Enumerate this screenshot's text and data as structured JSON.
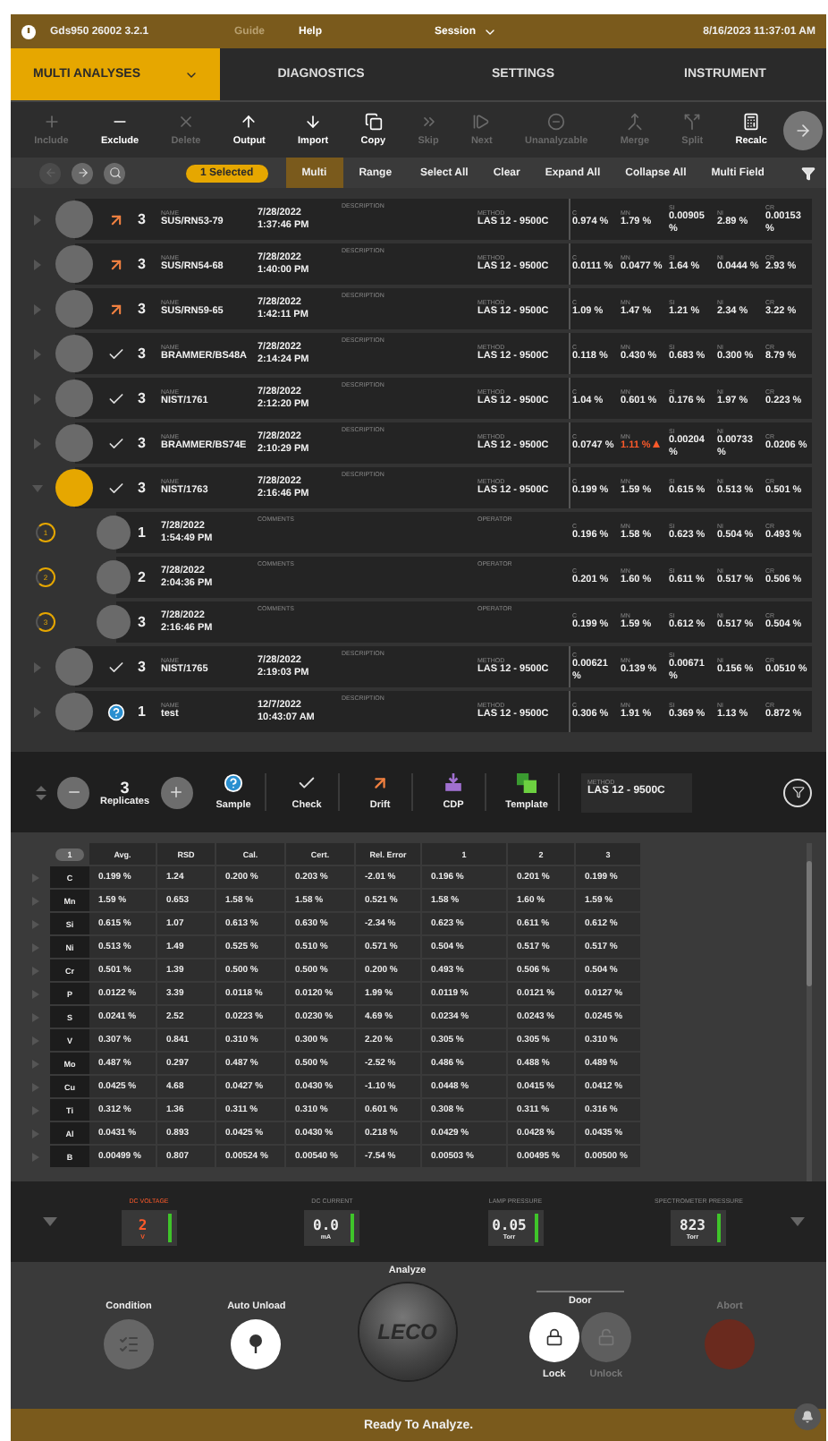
{
  "title_bar": {
    "app": "Gds950 26002 3.2.1",
    "menu": [
      {
        "label": "Guide",
        "disabled": true
      },
      {
        "label": "Help",
        "disabled": false
      }
    ],
    "session": "Session",
    "datetime": "8/16/2023 11:37:01 AM"
  },
  "nav_tabs": [
    {
      "label": "MULTI ANALYSES",
      "selected": true
    },
    {
      "label": "DIAGNOSTICS",
      "selected": false
    },
    {
      "label": "SETTINGS",
      "selected": false
    },
    {
      "label": "INSTRUMENT",
      "selected": false
    }
  ],
  "toolbar": [
    {
      "label": "Include",
      "kind": "include",
      "disabled": true
    },
    {
      "label": "Exclude",
      "kind": "exclude",
      "disabled": false
    },
    {
      "label": "Delete",
      "kind": "delete",
      "disabled": true
    },
    {
      "label": "Output",
      "kind": "output",
      "disabled": false
    },
    {
      "label": "Import",
      "kind": "import",
      "disabled": false
    },
    {
      "label": "Copy",
      "kind": "copy",
      "disabled": false
    },
    {
      "label": "Skip",
      "kind": "skip",
      "disabled": true
    },
    {
      "label": "Next",
      "kind": "next",
      "disabled": true
    },
    {
      "label": "Unanalyzable",
      "kind": "unanalyzable",
      "disabled": true
    },
    {
      "label": "Merge",
      "kind": "merge",
      "disabled": true
    },
    {
      "label": "Split",
      "kind": "split",
      "disabled": true
    },
    {
      "label": "Recalc",
      "kind": "recalc",
      "disabled": false
    }
  ],
  "filter_bar": {
    "nav_buttons": [
      {
        "kind": "back",
        "disabled": true
      },
      {
        "kind": "forward",
        "disabled": false
      },
      {
        "kind": "search",
        "disabled": false
      }
    ],
    "selection": "1 Selected",
    "modes": [
      {
        "label": "Multi",
        "selected": true
      },
      {
        "label": "Range",
        "selected": false
      }
    ],
    "actions": [
      "Select All",
      "Clear",
      "Expand All",
      "Collapse All",
      "Multi Field"
    ]
  },
  "samples": [
    {
      "kind": "drift",
      "replicates": "3",
      "labels": [
        "NAME",
        "DESCRIPTION",
        "METHOD"
      ],
      "name": "SUS/RN53-79",
      "date": "7/28/2022",
      "time": "1:37:46 PM",
      "method": "LAS 12 - 9500C",
      "expanded": false,
      "selected": false,
      "values": [
        {
          "el": "C",
          "v": "0.974 %",
          "flag": false
        },
        {
          "el": "MN",
          "v": "1.79 %",
          "flag": false
        },
        {
          "el": "SI",
          "v": "0.00905 %",
          "flag": false
        },
        {
          "el": "NI",
          "v": "2.89 %",
          "flag": false
        },
        {
          "el": "CR",
          "v": "0.00153 %",
          "flag": false
        }
      ]
    },
    {
      "kind": "drift",
      "replicates": "3",
      "labels": [
        "NAME",
        "DESCRIPTION",
        "METHOD"
      ],
      "name": "SUS/RN54-68",
      "date": "7/28/2022",
      "time": "1:40:00 PM",
      "method": "LAS 12 - 9500C",
      "expanded": false,
      "selected": false,
      "values": [
        {
          "el": "C",
          "v": "0.0111 %",
          "flag": false
        },
        {
          "el": "MN",
          "v": "0.0477 %",
          "flag": false
        },
        {
          "el": "SI",
          "v": "1.64 %",
          "flag": false
        },
        {
          "el": "NI",
          "v": "0.0444 %",
          "flag": false
        },
        {
          "el": "CR",
          "v": "2.93 %",
          "flag": false
        }
      ]
    },
    {
      "kind": "drift",
      "replicates": "3",
      "labels": [
        "NAME",
        "DESCRIPTION",
        "METHOD"
      ],
      "name": "SUS/RN59-65",
      "date": "7/28/2022",
      "time": "1:42:11 PM",
      "method": "LAS 12 - 9500C",
      "expanded": false,
      "selected": false,
      "values": [
        {
          "el": "C",
          "v": "1.09 %",
          "flag": false
        },
        {
          "el": "MN",
          "v": "1.47 %",
          "flag": false
        },
        {
          "el": "SI",
          "v": "1.21 %",
          "flag": false
        },
        {
          "el": "NI",
          "v": "2.34 %",
          "flag": false
        },
        {
          "el": "CR",
          "v": "3.22 %",
          "flag": false
        }
      ]
    },
    {
      "kind": "check",
      "replicates": "3",
      "labels": [
        "NAME",
        "DESCRIPTION",
        "METHOD"
      ],
      "name": "BRAMMER/BS48A",
      "date": "7/28/2022",
      "time": "2:14:24 PM",
      "method": "LAS 12 - 9500C",
      "expanded": false,
      "selected": false,
      "values": [
        {
          "el": "C",
          "v": "0.118 %",
          "flag": false
        },
        {
          "el": "MN",
          "v": "0.430 %",
          "flag": false
        },
        {
          "el": "SI",
          "v": "0.683 %",
          "flag": false
        },
        {
          "el": "NI",
          "v": "0.300 %",
          "flag": false
        },
        {
          "el": "CR",
          "v": "8.79 %",
          "flag": false
        }
      ]
    },
    {
      "kind": "check",
      "replicates": "3",
      "labels": [
        "NAME",
        "DESCRIPTION",
        "METHOD"
      ],
      "name": "NIST/1761",
      "date": "7/28/2022",
      "time": "2:12:20 PM",
      "method": "LAS 12 - 9500C",
      "expanded": false,
      "selected": false,
      "values": [
        {
          "el": "C",
          "v": "1.04 %",
          "flag": false
        },
        {
          "el": "MN",
          "v": "0.601 %",
          "flag": false
        },
        {
          "el": "SI",
          "v": "0.176 %",
          "flag": false
        },
        {
          "el": "NI",
          "v": "1.97 %",
          "flag": false
        },
        {
          "el": "CR",
          "v": "0.223 %",
          "flag": false
        }
      ]
    },
    {
      "kind": "check",
      "replicates": "3",
      "labels": [
        "NAME",
        "DESCRIPTION",
        "METHOD"
      ],
      "name": "BRAMMER/BS74E",
      "date": "7/28/2022",
      "time": "2:10:29 PM",
      "method": "LAS 12 - 9500C",
      "expanded": false,
      "selected": false,
      "values": [
        {
          "el": "C",
          "v": "0.0747 %",
          "flag": false
        },
        {
          "el": "MN",
          "v": "1.11 %",
          "flag": true
        },
        {
          "el": "SI",
          "v": "0.00204 %",
          "flag": false
        },
        {
          "el": "NI",
          "v": "0.00733 %",
          "flag": false
        },
        {
          "el": "CR",
          "v": "0.0206 %",
          "flag": false
        }
      ]
    },
    {
      "kind": "check",
      "replicates": "3",
      "labels": [
        "NAME",
        "DESCRIPTION",
        "METHOD"
      ],
      "name": "NIST/1763",
      "date": "7/28/2022",
      "time": "2:16:46 PM",
      "method": "LAS 12 - 9500C",
      "expanded": true,
      "selected": true,
      "values": [
        {
          "el": "C",
          "v": "0.199 %",
          "flag": false
        },
        {
          "el": "MN",
          "v": "1.59 %",
          "flag": false
        },
        {
          "el": "SI",
          "v": "0.615 %",
          "flag": false
        },
        {
          "el": "NI",
          "v": "0.513 %",
          "flag": false
        },
        {
          "el": "CR",
          "v": "0.501 %",
          "flag": false
        }
      ],
      "children": [
        {
          "ring": "1",
          "number": "1",
          "labels": [
            "COMMENTS",
            "OPERATOR"
          ],
          "date": "7/28/2022",
          "time": "1:54:49 PM",
          "values": [
            {
              "el": "C",
              "v": "0.196 %",
              "flag": false
            },
            {
              "el": "MN",
              "v": "1.58 %",
              "flag": false
            },
            {
              "el": "SI",
              "v": "0.623 %",
              "flag": false
            },
            {
              "el": "NI",
              "v": "0.504 %",
              "flag": false
            },
            {
              "el": "CR",
              "v": "0.493 %",
              "flag": false
            }
          ]
        },
        {
          "ring": "2",
          "number": "2",
          "labels": [
            "COMMENTS",
            "OPERATOR"
          ],
          "date": "7/28/2022",
          "time": "2:04:36 PM",
          "values": [
            {
              "el": "C",
              "v": "0.201 %",
              "flag": false
            },
            {
              "el": "MN",
              "v": "1.60 %",
              "flag": false
            },
            {
              "el": "SI",
              "v": "0.611 %",
              "flag": false
            },
            {
              "el": "NI",
              "v": "0.517 %",
              "flag": false
            },
            {
              "el": "CR",
              "v": "0.506 %",
              "flag": false
            }
          ]
        },
        {
          "ring": "3",
          "number": "3",
          "labels": [
            "COMMENTS",
            "OPERATOR"
          ],
          "date": "7/28/2022",
          "time": "2:16:46 PM",
          "values": [
            {
              "el": "C",
              "v": "0.199 %",
              "flag": false
            },
            {
              "el": "MN",
              "v": "1.59 %",
              "flag": false
            },
            {
              "el": "SI",
              "v": "0.612 %",
              "flag": false
            },
            {
              "el": "NI",
              "v": "0.517 %",
              "flag": false
            },
            {
              "el": "CR",
              "v": "0.504 %",
              "flag": false
            }
          ]
        }
      ]
    },
    {
      "kind": "check",
      "replicates": "3",
      "labels": [
        "NAME",
        "DESCRIPTION",
        "METHOD"
      ],
      "name": "NIST/1765",
      "date": "7/28/2022",
      "time": "2:19:03 PM",
      "method": "LAS 12 - 9500C",
      "expanded": false,
      "selected": false,
      "values": [
        {
          "el": "C",
          "v": "0.00621 %",
          "flag": false
        },
        {
          "el": "MN",
          "v": "0.139 %",
          "flag": false
        },
        {
          "el": "SI",
          "v": "0.00671 %",
          "flag": false
        },
        {
          "el": "NI",
          "v": "0.156 %",
          "flag": false
        },
        {
          "el": "CR",
          "v": "0.0510 %",
          "flag": false
        }
      ]
    },
    {
      "kind": "sample",
      "replicates": "1",
      "labels": [
        "NAME",
        "DESCRIPTION",
        "METHOD"
      ],
      "name": "test",
      "date": "12/7/2022",
      "time": "10:43:07 AM",
      "method": "LAS 12 - 9500C",
      "expanded": false,
      "selected": false,
      "values": [
        {
          "el": "C",
          "v": "0.306 %",
          "flag": false
        },
        {
          "el": "MN",
          "v": "1.91 %",
          "flag": false
        },
        {
          "el": "SI",
          "v": "0.369 %",
          "flag": false
        },
        {
          "el": "NI",
          "v": "1.13 %",
          "flag": false
        },
        {
          "el": "CR",
          "v": "0.872 %",
          "flag": false
        }
      ]
    }
  ],
  "analysis_bar": {
    "replicates": "3",
    "replicates_label": "Replicates",
    "types": [
      {
        "label": "Sample",
        "kind": "sample"
      },
      {
        "label": "Check",
        "kind": "check"
      },
      {
        "label": "Drift",
        "kind": "drift"
      },
      {
        "label": "CDP",
        "kind": "cdp"
      },
      {
        "label": "Template",
        "kind": "template"
      }
    ],
    "method_label": "METHOD",
    "method": "LAS 12 - 9500C"
  },
  "results": {
    "columns": [
      "1",
      "Avg.",
      "RSD",
      "Cal.",
      "Cert.",
      "Rel. Error",
      "1",
      "2",
      "3"
    ],
    "rows": [
      {
        "cells": [
          "C",
          "0.199 %",
          "1.24",
          "0.200 %",
          "0.203 %",
          "-2.01 %",
          "0.196 %",
          "0.201 %",
          "0.199 %"
        ]
      },
      {
        "cells": [
          "Mn",
          "1.59 %",
          "0.653",
          "1.58 %",
          "1.58 %",
          "0.521 %",
          "1.58 %",
          "1.60 %",
          "1.59 %"
        ]
      },
      {
        "cells": [
          "Si",
          "0.615 %",
          "1.07",
          "0.613 %",
          "0.630 %",
          "-2.34 %",
          "0.623 %",
          "0.611 %",
          "0.612 %"
        ]
      },
      {
        "cells": [
          "Ni",
          "0.513 %",
          "1.49",
          "0.525 %",
          "0.510 %",
          "0.571 %",
          "0.504 %",
          "0.517 %",
          "0.517 %"
        ]
      },
      {
        "cells": [
          "Cr",
          "0.501 %",
          "1.39",
          "0.500 %",
          "0.500 %",
          "0.200 %",
          "0.493 %",
          "0.506 %",
          "0.504 %"
        ]
      },
      {
        "cells": [
          "P",
          "0.0122 %",
          "3.39",
          "0.0118 %",
          "0.0120 %",
          "1.99 %",
          "0.0119 %",
          "0.0121 %",
          "0.0127 %"
        ]
      },
      {
        "cells": [
          "S",
          "0.0241 %",
          "2.52",
          "0.0223 %",
          "0.0230 %",
          "4.69 %",
          "0.0234 %",
          "0.0243 %",
          "0.0245 %"
        ]
      },
      {
        "cells": [
          "V",
          "0.307 %",
          "0.841",
          "0.310 %",
          "0.300 %",
          "2.20 %",
          "0.305 %",
          "0.305 %",
          "0.310 %"
        ]
      },
      {
        "cells": [
          "Mo",
          "0.487 %",
          "0.297",
          "0.487 %",
          "0.500 %",
          "-2.52 %",
          "0.486 %",
          "0.488 %",
          "0.489 %"
        ]
      },
      {
        "cells": [
          "Cu",
          "0.0425 %",
          "4.68",
          "0.0427 %",
          "0.0430 %",
          "-1.10 %",
          "0.0448 %",
          "0.0415 %",
          "0.0412 %"
        ]
      },
      {
        "cells": [
          "Ti",
          "0.312 %",
          "1.36",
          "0.311 %",
          "0.310 %",
          "0.601 %",
          "0.308 %",
          "0.311 %",
          "0.316 %"
        ]
      },
      {
        "cells": [
          "Al",
          "0.0431 %",
          "0.893",
          "0.0425 %",
          "0.0430 %",
          "0.218 %",
          "0.0429 %",
          "0.0428 %",
          "0.0435 %"
        ]
      },
      {
        "cells": [
          "B",
          "0.00499 %",
          "0.807",
          "0.00524 %",
          "0.00540 %",
          "-7.54 %",
          "0.00503 %",
          "0.00495 %",
          "0.00500 %"
        ]
      }
    ]
  },
  "gauges": [
    {
      "label": "DC VOLTAGE",
      "value": "2",
      "unit": "V",
      "alert": true
    },
    {
      "label": "DC CURRENT",
      "value": "0.0",
      "unit": "mA",
      "alert": false
    },
    {
      "label": "LAMP PRESSURE",
      "value": "0.05",
      "unit": "Torr",
      "alert": false
    },
    {
      "label": "SPECTROMETER PRESSURE",
      "value": "823",
      "unit": "Torr",
      "alert": false
    }
  ],
  "controls": {
    "condition": {
      "label": "Condition",
      "on": false
    },
    "auto_unload": {
      "label": "Auto Unload",
      "on": true
    },
    "analyze": {
      "label": "Analyze",
      "logo": "LECO"
    },
    "door": {
      "label": "Door",
      "options": [
        {
          "label": "Lock",
          "selected": true
        },
        {
          "label": "Unlock",
          "selected": false
        }
      ]
    },
    "abort": {
      "label": "Abort",
      "disabled": true
    }
  },
  "status_bar": {
    "message": "Ready To Analyze."
  }
}
